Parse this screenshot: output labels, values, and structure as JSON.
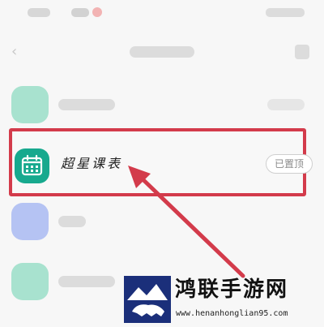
{
  "list": {
    "highlighted_item": {
      "name": "超星课表",
      "pin_label": "已置顶",
      "icon": "calendar-icon",
      "icon_color": "#17a98e"
    }
  },
  "colors": {
    "highlight_border": "#d33b4b",
    "arrow": "#d33b4b"
  },
  "watermark": {
    "brand": "鸿联手游网",
    "url": "www.henanhonglian95.com",
    "logo": "bull-logo-icon"
  }
}
